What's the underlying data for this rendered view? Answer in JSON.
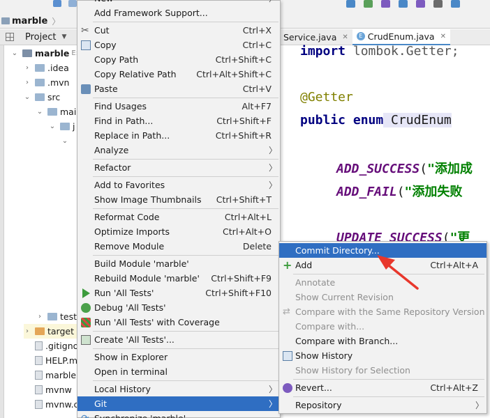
{
  "toolbar": {
    "project_name": "marble"
  },
  "project_panel": {
    "title": "Project",
    "tree": [
      {
        "label": "marble",
        "path": "E:\\",
        "level": 0,
        "type": "folder-dark",
        "expanded": true
      },
      {
        "label": ".idea",
        "level": 1,
        "type": "folder",
        "expanded": false
      },
      {
        "label": ".mvn",
        "level": 1,
        "type": "folder",
        "expanded": false
      },
      {
        "label": "src",
        "level": 1,
        "type": "folder",
        "expanded": true
      },
      {
        "label": "main",
        "level": 2,
        "type": "folder",
        "expanded": true
      },
      {
        "label": "j",
        "level": 3,
        "type": "folder",
        "expanded": true
      },
      {
        "label": "",
        "level": 4,
        "type": "arrow-only",
        "expanded": true
      },
      {
        "label": "test",
        "level": 2,
        "type": "folder",
        "expanded": false
      },
      {
        "label": "target",
        "level": 1,
        "type": "folder-orange",
        "expanded": false
      },
      {
        "label": ".gitigno",
        "level": 1,
        "type": "file"
      },
      {
        "label": "HELP.m",
        "level": 1,
        "type": "file"
      },
      {
        "label": "marble.",
        "level": 1,
        "type": "file"
      },
      {
        "label": "mvnw",
        "level": 1,
        "type": "file"
      },
      {
        "label": "mvnw.c",
        "level": 1,
        "type": "file"
      }
    ]
  },
  "editor": {
    "tabs": [
      {
        "label": "Service.java",
        "active": false
      },
      {
        "label": "CrudEnum.java",
        "active": true
      }
    ],
    "lines": [
      {
        "kw": "import",
        "rest": " lombok.Getter;"
      },
      {
        "anno": "@Getter"
      },
      {
        "kw": "public enum",
        "rest": " CrudEnum"
      },
      {
        "const": "ADD_SUCCESS",
        "rest": "(",
        "str": "\"添加成"
      },
      {
        "const": "ADD_FAIL",
        "rest": "(",
        "str": "\"添加失败"
      },
      {
        "const": "UPDATE_SUCCESS",
        "rest": "(",
        "str": "\"更"
      }
    ]
  },
  "context_menu": {
    "items": [
      {
        "label": "New",
        "shortcut": "",
        "submenu": true
      },
      {
        "label": "Add Framework Support...",
        "shortcut": ""
      },
      {
        "sep": true
      },
      {
        "label": "Cut",
        "shortcut": "Ctrl+X",
        "icon": "scissors-icon"
      },
      {
        "label": "Copy",
        "shortcut": "Ctrl+C",
        "icon": "copy-icon"
      },
      {
        "label": "Copy Path",
        "shortcut": "Ctrl+Shift+C"
      },
      {
        "label": "Copy Relative Path",
        "shortcut": "Ctrl+Alt+Shift+C"
      },
      {
        "label": "Paste",
        "shortcut": "Ctrl+V",
        "icon": "paste-icon"
      },
      {
        "sep": true
      },
      {
        "label": "Find Usages",
        "shortcut": "Alt+F7"
      },
      {
        "label": "Find in Path...",
        "shortcut": "Ctrl+Shift+F"
      },
      {
        "label": "Replace in Path...",
        "shortcut": "Ctrl+Shift+R"
      },
      {
        "label": "Analyze",
        "shortcut": "",
        "submenu": true
      },
      {
        "sep": true
      },
      {
        "label": "Refactor",
        "shortcut": "",
        "submenu": true
      },
      {
        "sep": true
      },
      {
        "label": "Add to Favorites",
        "shortcut": "",
        "submenu": true
      },
      {
        "label": "Show Image Thumbnails",
        "shortcut": "Ctrl+Shift+T"
      },
      {
        "sep": true
      },
      {
        "label": "Reformat Code",
        "shortcut": "Ctrl+Alt+L"
      },
      {
        "label": "Optimize Imports",
        "shortcut": "Ctrl+Alt+O"
      },
      {
        "label": "Remove Module",
        "shortcut": "Delete"
      },
      {
        "sep": true
      },
      {
        "label": "Build Module 'marble'",
        "shortcut": ""
      },
      {
        "label": "Rebuild Module 'marble'",
        "shortcut": "Ctrl+Shift+F9"
      },
      {
        "label": "Run 'All Tests'",
        "shortcut": "Ctrl+Shift+F10",
        "icon": "run-icon"
      },
      {
        "label": "Debug 'All Tests'",
        "shortcut": "",
        "icon": "bug-icon"
      },
      {
        "label": "Run 'All Tests' with Coverage",
        "shortcut": "",
        "icon": "coverage-icon"
      },
      {
        "sep": true
      },
      {
        "label": "Create 'All Tests'...",
        "shortcut": "",
        "icon": "test-config-icon"
      },
      {
        "sep": true
      },
      {
        "label": "Show in Explorer",
        "shortcut": ""
      },
      {
        "label": "Open in terminal",
        "shortcut": ""
      },
      {
        "sep": true
      },
      {
        "label": "Local History",
        "shortcut": "",
        "submenu": true
      },
      {
        "label": "Git",
        "shortcut": "",
        "submenu": true,
        "selected": true
      },
      {
        "label": "Synchronize 'marble'",
        "shortcut": "",
        "icon": "sync-icon"
      }
    ]
  },
  "git_submenu": {
    "items": [
      {
        "label": "Commit Directory...",
        "shortcut": "",
        "selected": true
      },
      {
        "label": "Add",
        "shortcut": "Ctrl+Alt+A",
        "icon": "plus-icon"
      },
      {
        "sep": true
      },
      {
        "label": "Annotate",
        "disabled": true
      },
      {
        "label": "Show Current Revision",
        "disabled": true
      },
      {
        "label": "Compare with the Same Repository Version",
        "disabled": true,
        "icon": "compare-icon"
      },
      {
        "label": "Compare with...",
        "disabled": true
      },
      {
        "label": "Compare with Branch...",
        "disabled": false
      },
      {
        "label": "Show History",
        "disabled": false,
        "icon": "history-icon"
      },
      {
        "label": "Show History for Selection",
        "disabled": true
      },
      {
        "sep": true
      },
      {
        "label": "Revert...",
        "shortcut": "Ctrl+Alt+Z",
        "icon": "revert-icon"
      },
      {
        "sep": true
      },
      {
        "label": "Repository",
        "submenu": true
      }
    ]
  },
  "colors": {
    "selection": "#2f6ec2",
    "annotation_arrow": "#e8372c",
    "menu_bg": "#f2f2f2"
  }
}
